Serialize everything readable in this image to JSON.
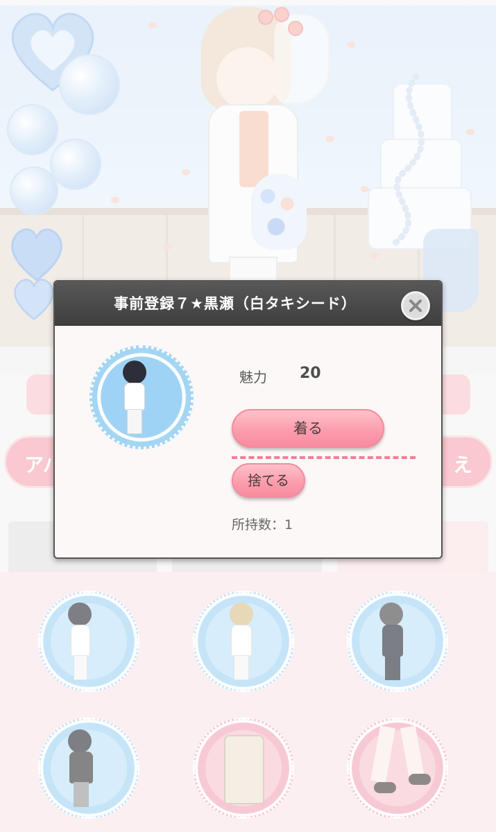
{
  "background": {
    "left_pill_text": "アバ",
    "right_pill_text": "え"
  },
  "modal": {
    "title": "事前登録７★黒瀬（白タキシード）",
    "stat_label": "魅力",
    "stat_value": "20",
    "wear_label": "着る",
    "discard_label": "捨てる",
    "count_label": "所持数：1"
  },
  "items": [
    {
      "name": "white-tuxedo-dark-hair",
      "frame": "blue"
    },
    {
      "name": "white-outfit-blonde",
      "frame": "blue"
    },
    {
      "name": "black-suit-glasses",
      "frame": "blue"
    },
    {
      "name": "black-hoodie",
      "frame": "blue"
    },
    {
      "name": "beige-trench-coat",
      "frame": "pink"
    },
    {
      "name": "brown-shoes",
      "frame": "pink"
    }
  ],
  "colors": {
    "accent_pink": "#f88c9f",
    "header_dark": "#4a4a4a",
    "frame_blue": "#a2d3f3",
    "frame_pink": "#f3a9ba"
  },
  "icons": [
    "close-icon"
  ]
}
